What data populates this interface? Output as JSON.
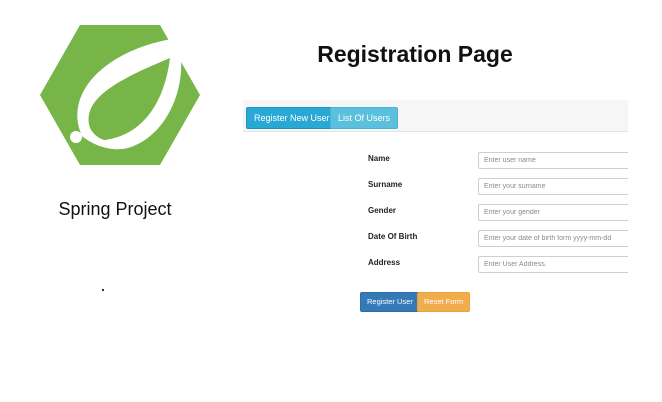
{
  "branding": {
    "logo_icon": "spring-leaf-logo",
    "brand_color": "#77b548",
    "project_label": "Spring Project"
  },
  "header": {
    "title": "Registration Page"
  },
  "nav": {
    "register_label": "Register New User",
    "list_label": "List Of Users"
  },
  "form": {
    "fields": [
      {
        "label": "Name",
        "placeholder": "Enter user name"
      },
      {
        "label": "Surname",
        "placeholder": "Enter your surname"
      },
      {
        "label": "Gender",
        "placeholder": "Enter your gender"
      },
      {
        "label": "Date Of Birth",
        "placeholder": "Enter your date of birth form yyyy-mm-dd"
      },
      {
        "label": "Address",
        "placeholder": "Enter User Address."
      }
    ],
    "submit_label": "Register User",
    "reset_label": "Reset Form"
  }
}
